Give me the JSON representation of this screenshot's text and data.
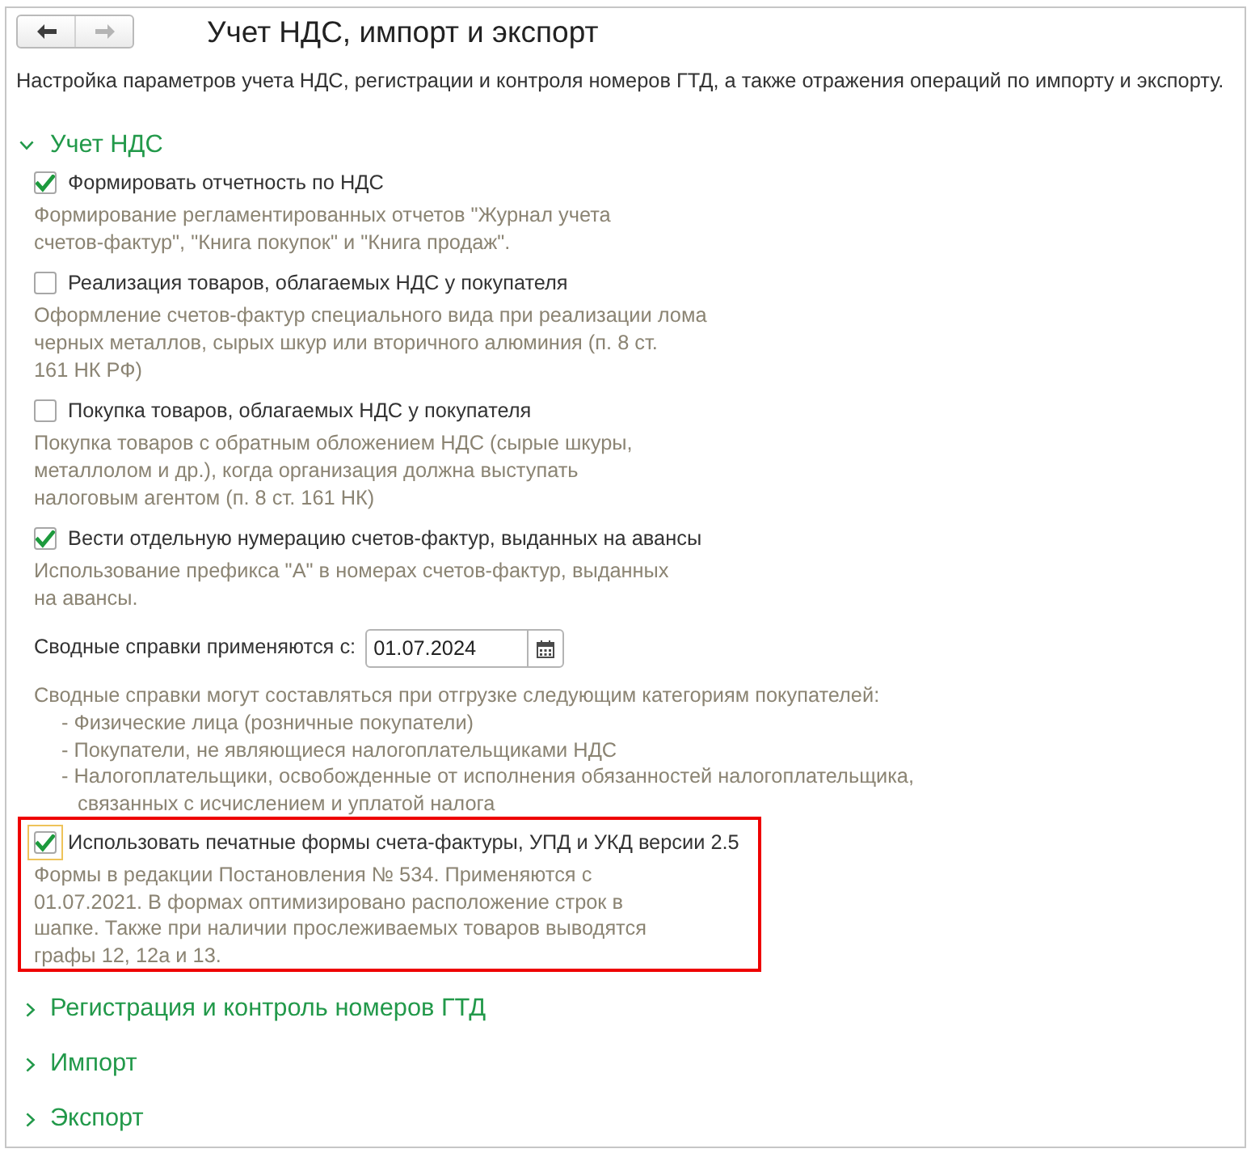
{
  "navigation": [
    {
      "kind": "back",
      "disabled": false
    },
    {
      "kind": "forward",
      "disabled": true
    }
  ],
  "title": "Учет НДС, импорт и экспорт",
  "description": "Настройка параметров учета НДС, регистрации и контроля номеров ГТД, а также отражения операций по импорту и экспорту.",
  "sections": [
    {
      "title": "Учет НДС",
      "expanded": true,
      "items": [
        {
          "kind": "checkbox",
          "label": "Формировать отчетность по НДС",
          "checked": true,
          "focused": false,
          "highlighted": false,
          "hint": "Формирование регламентированных отчетов \"Журнал учета\nсчетов-фактур\", \"Книга покупок\" и \"Книга продаж\"."
        },
        {
          "kind": "checkbox",
          "label": "Реализация товаров, облагаемых НДС у покупателя",
          "checked": false,
          "focused": false,
          "highlighted": false,
          "hint": "Оформление счетов-фактур специального вида при реализации лома\nчерных металлов, сырых шкур или вторичного алюминия (п. 8 ст.\n161 НК РФ)"
        },
        {
          "kind": "checkbox",
          "label": "Покупка товаров, облагаемых НДС у покупателя",
          "checked": false,
          "focused": false,
          "highlighted": false,
          "hint": "Покупка товаров с обратным обложением НДС (сырые шкуры,\nметаллолом и др.), когда организация должна выступать\nналоговым агентом (п. 8 ст. 161 НК)"
        },
        {
          "kind": "checkbox",
          "label": "Вести отдельную нумерацию счетов-фактур, выданных на авансы",
          "checked": true,
          "focused": false,
          "highlighted": false,
          "hint": "Использование префикса \"А\" в номерах счетов-фактур, выданных\nна авансы."
        },
        {
          "kind": "date",
          "label": "Сводные справки применяются с:",
          "value": "01.07.2024",
          "highlighted": false,
          "hint": "Сводные справки могут составляться при отгрузке следующим категориям покупателей:",
          "hint_list": [
            "- Физические лица (розничные покупатели)",
            "- Покупатели, не являющиеся налогоплательщиками НДС",
            "- Налогоплательщики, освобожденные от исполнения обязанностей налогоплательщика,\nсвязанных с исчислением и уплатой налога"
          ]
        },
        {
          "kind": "checkbox",
          "label": "Использовать печатные формы счета-фактуры, УПД и УКД версии 2.5",
          "checked": true,
          "focused": true,
          "highlighted": true,
          "hint": "Формы в редакции Постановления № 534. Применяются с\n01.07.2021. В формах оптимизировано расположение строк в\nшапке. Также при наличии прослеживаемых товаров выводятся\nграфы 12, 12а и 13."
        }
      ]
    },
    {
      "title": "Регистрация и контроль номеров ГТД",
      "expanded": false
    },
    {
      "title": "Импорт",
      "expanded": false
    },
    {
      "title": "Экспорт",
      "expanded": false
    }
  ]
}
